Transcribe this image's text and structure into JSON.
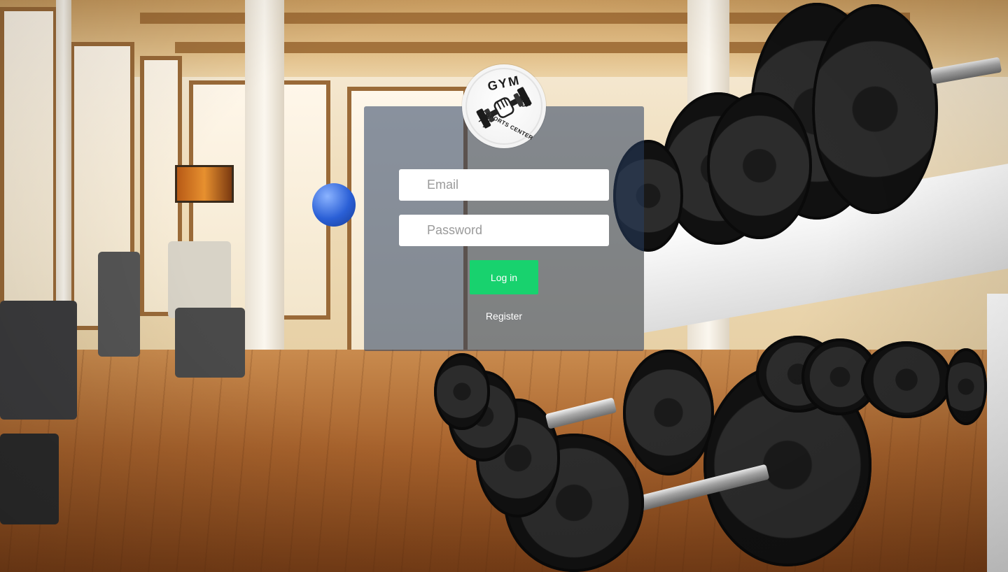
{
  "logo": {
    "top_text": "GYM",
    "bottom_text": "SPORTS CENTER"
  },
  "login_form": {
    "email_placeholder": "Email",
    "email_value": "",
    "password_placeholder": "Password",
    "password_value": "",
    "login_label": "Log in",
    "register_label": "Register"
  },
  "colors": {
    "login_button": "#18d26e",
    "panel_overlay": "#283e60"
  },
  "icons": {
    "logo": "dumbbell-fist-icon"
  }
}
